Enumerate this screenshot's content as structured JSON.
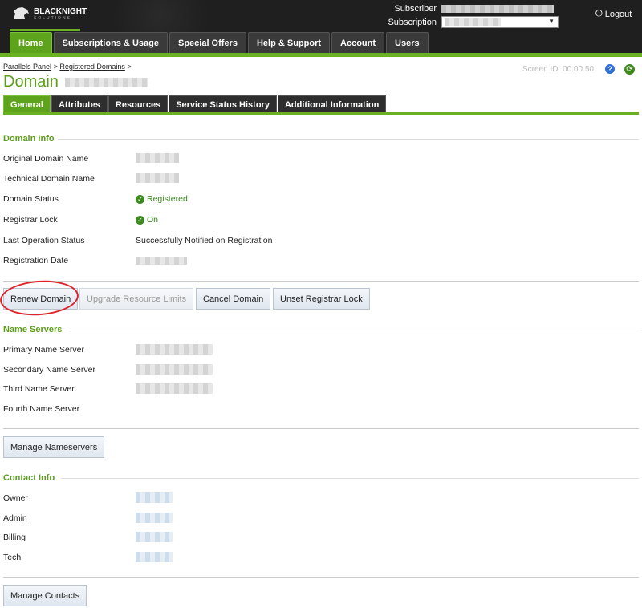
{
  "header": {
    "logo_text": "BLACKNIGHT",
    "logo_sub": "SOLUTIONS",
    "subscriber_label": "Subscriber",
    "subscription_label": "Subscription",
    "logout_label": "Logout"
  },
  "nav": {
    "tabs": [
      {
        "label": "Home",
        "active": true
      },
      {
        "label": "Subscriptions & Usage",
        "active": false
      },
      {
        "label": "Special Offers",
        "active": false
      },
      {
        "label": "Help & Support",
        "active": false
      },
      {
        "label": "Account",
        "active": false
      },
      {
        "label": "Users",
        "active": false
      }
    ]
  },
  "breadcrumb": {
    "items": [
      "Parallels Panel",
      "Registered Domains"
    ],
    "separator": ">"
  },
  "page": {
    "title": "Domain",
    "screen_id_label": "Screen ID:",
    "screen_id_value": "00.00.50"
  },
  "subtabs": [
    {
      "label": "General",
      "active": true
    },
    {
      "label": "Attributes",
      "active": false
    },
    {
      "label": "Resources",
      "active": false
    },
    {
      "label": "Service Status History",
      "active": false
    },
    {
      "label": "Additional Information",
      "active": false
    }
  ],
  "domain_info": {
    "title": "Domain Info",
    "fields": {
      "original_domain_name": "Original Domain Name",
      "technical_domain_name": "Technical Domain Name",
      "domain_status": "Domain Status",
      "domain_status_value": "Registered",
      "registrar_lock": "Registrar Lock",
      "registrar_lock_value": "On",
      "last_operation_status": "Last Operation Status",
      "last_operation_status_value": "Successfully Notified on Registration",
      "registration_date": "Registration Date"
    }
  },
  "actions": {
    "renew": "Renew Domain",
    "upgrade": "Upgrade Resource Limits",
    "cancel": "Cancel Domain",
    "unset_lock": "Unset Registrar Lock"
  },
  "name_servers": {
    "title": "Name Servers",
    "primary": "Primary Name Server",
    "secondary": "Secondary Name Server",
    "third": "Third Name Server",
    "fourth": "Fourth Name Server",
    "manage": "Manage Nameservers"
  },
  "contact_info": {
    "title": "Contact Info",
    "owner": "Owner",
    "admin": "Admin",
    "billing": "Billing",
    "tech": "Tech",
    "manage": "Manage Contacts"
  },
  "colors": {
    "accent_green": "#6ab023",
    "annotation_red": "#e0232b"
  }
}
